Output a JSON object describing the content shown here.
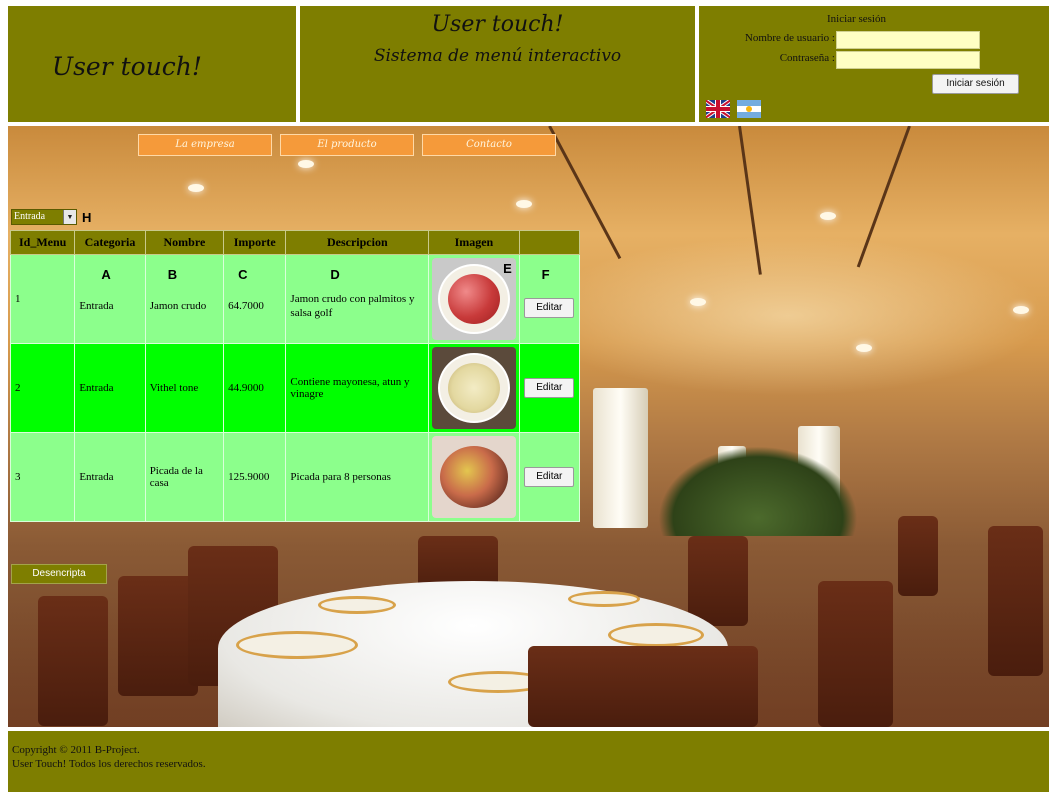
{
  "header": {
    "brand_left": "User touch!",
    "brand_center": "User touch!",
    "subtitle": "Sistema de menú interactivo"
  },
  "login": {
    "title": "Iniciar sesión",
    "username_label": "Nombre de usuario :",
    "password_label": "Contraseña :",
    "username_value": "",
    "password_value": "",
    "submit_label": "Iniciar sesión"
  },
  "languages": [
    "english-flag-icon",
    "argentina-flag-icon"
  ],
  "nav": {
    "items": [
      {
        "label": "La empresa"
      },
      {
        "label": "El producto"
      },
      {
        "label": "Contacto"
      }
    ]
  },
  "category_select": {
    "value": "Entrada"
  },
  "annotations": {
    "H": "H",
    "A": "A",
    "B": "B",
    "C": "C",
    "D": "D",
    "E": "E",
    "F": "F"
  },
  "table": {
    "headers": [
      "Id_Menu",
      "Categoria",
      "Nombre",
      "Importe",
      "Descripcion",
      "Imagen",
      ""
    ],
    "rows": [
      {
        "id": "1",
        "categoria": "Entrada",
        "nombre": "Jamon crudo",
        "importe": "64.7000",
        "descripcion": "Jamon crudo con palmitos y salsa golf",
        "edit_label": "Editar"
      },
      {
        "id": "2",
        "categoria": "Entrada",
        "nombre": "Vithel tone",
        "importe": "44.9000",
        "descripcion": "Contiene mayonesa, atun y vinagre",
        "edit_label": "Editar"
      },
      {
        "id": "3",
        "categoria": "Entrada",
        "nombre": "Picada de la casa",
        "importe": "125.9000",
        "descripcion": "Picada para 8 personas",
        "edit_label": "Editar"
      }
    ]
  },
  "decrypt_label": "Desencripta",
  "footer": {
    "line1": "Copyright © 2011 B-Project.",
    "line2": "User Touch! Todos los derechos reservados."
  },
  "colors": {
    "olive": "#7e7e00",
    "row_light": "#8cff8c",
    "row_bright": "#00ff00",
    "nav_orange": "#f59a3a",
    "input_yellow": "#ffffc4"
  }
}
